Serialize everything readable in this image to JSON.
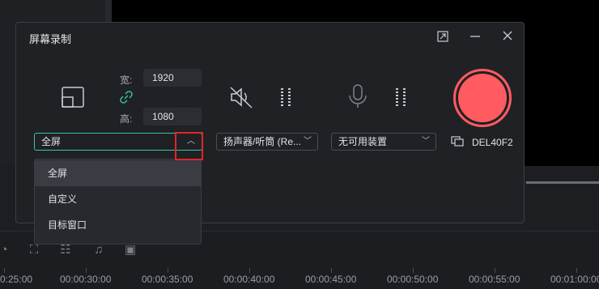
{
  "dialog": {
    "title": "屏幕录制"
  },
  "dimensions": {
    "width_label": "宽:",
    "width_value": "1920",
    "height_label": "高:",
    "height_value": "1080"
  },
  "dropdowns": {
    "screen_mode": "全屏",
    "speaker": "扬声器/听筒 (Re...",
    "microphone": "无可用装置"
  },
  "display_name": "DEL40F2",
  "screen_menu": {
    "items": [
      "全屏",
      "自定义",
      "目标窗口"
    ]
  },
  "timeline": {
    "labels": [
      "0:25:00",
      "00:00:30:00",
      "00:00:35:00",
      "00:00:40:00",
      "00:00:45:00",
      "00:00:50:00",
      "00:00:55:00",
      "00:01:00:00"
    ]
  },
  "colors": {
    "record": "#ff5b61",
    "accent": "#37c6a8",
    "highlight": "#e0262a"
  },
  "icons": [
    "region-select-icon",
    "link-icon",
    "speaker-muted-icon",
    "microphone-icon",
    "level-meter-icon",
    "monitor-icon",
    "expand-icon",
    "minimize-icon",
    "close-icon"
  ]
}
